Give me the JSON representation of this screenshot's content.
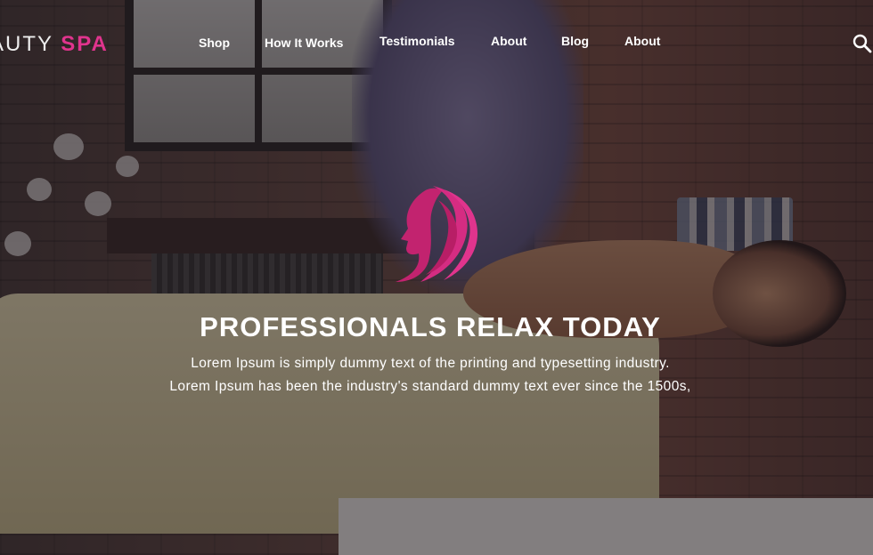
{
  "brand": {
    "name_part1": "AUTY",
    "name_part2": "SPA",
    "accent_color": "#e0348d"
  },
  "nav": {
    "items": [
      {
        "label": "Shop"
      },
      {
        "label": "How It Works"
      },
      {
        "label": "Testimonials"
      },
      {
        "label": "About"
      },
      {
        "label": "Blog"
      },
      {
        "label": "About"
      }
    ],
    "search_icon": "search-icon"
  },
  "hero": {
    "emblem_icon": "woman-profile-logo-icon",
    "title": "PROFESSIONALS RELAX TODAY",
    "line1": "Lorem Ipsum is simply dummy text of the printing and typesetting industry.",
    "line2": "Lorem Ipsum has been the industry's standard dummy text ever since the 1500s,"
  }
}
